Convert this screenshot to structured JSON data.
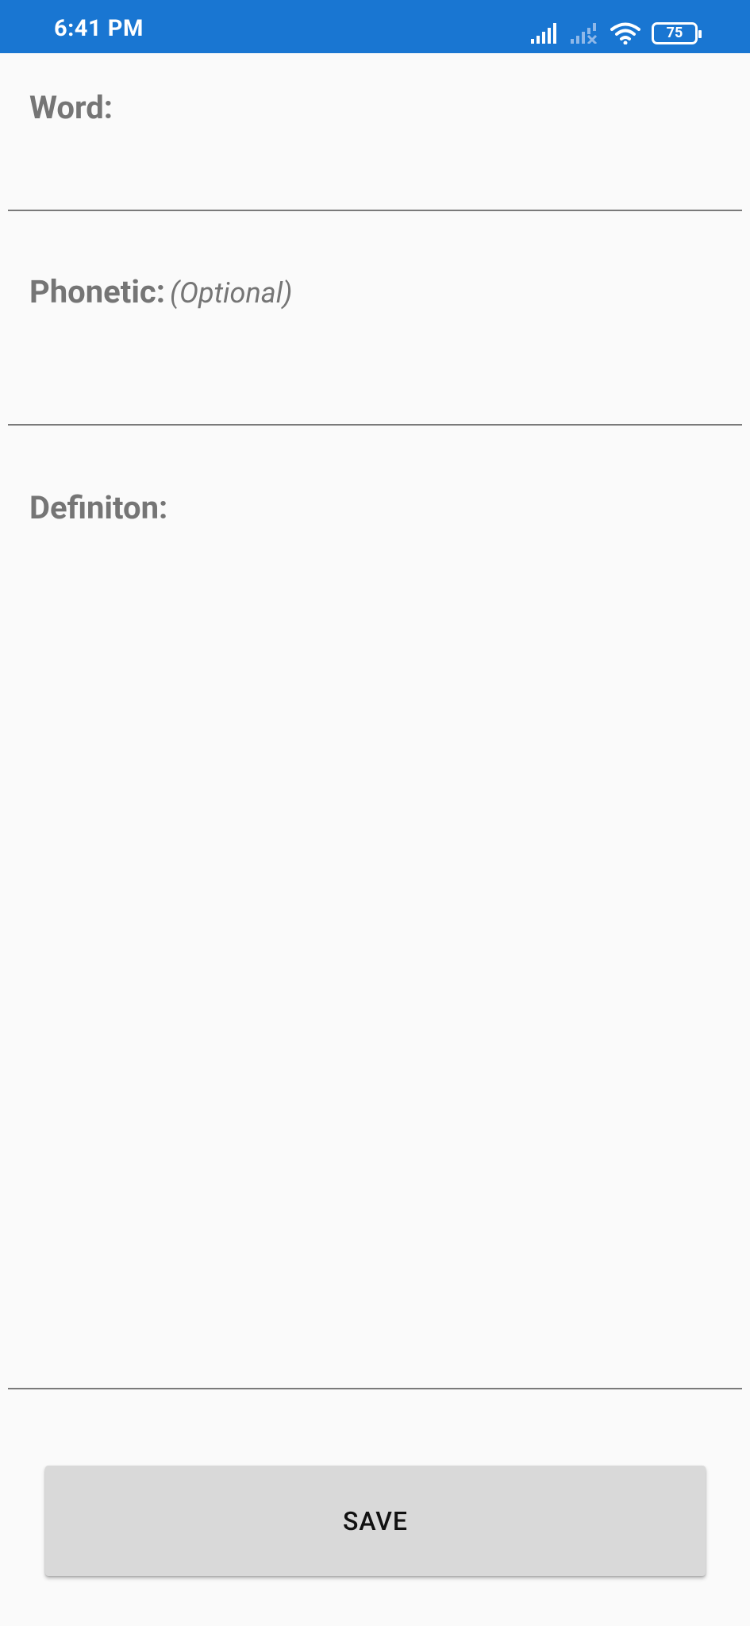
{
  "status_bar": {
    "time": "6:41 PM",
    "battery_level": "75",
    "background_color": "#1976d2",
    "icons": [
      "signal-icon",
      "signal-no-service-icon",
      "wifi-icon",
      "battery-icon"
    ]
  },
  "form": {
    "word_label": "Word:",
    "word_value": "",
    "phonetic_label": "Phonetic:",
    "phonetic_hint": "(Optional)",
    "phonetic_value": "",
    "definition_label": "Definiton:",
    "definition_value": ""
  },
  "save_button_label": "SAVE"
}
